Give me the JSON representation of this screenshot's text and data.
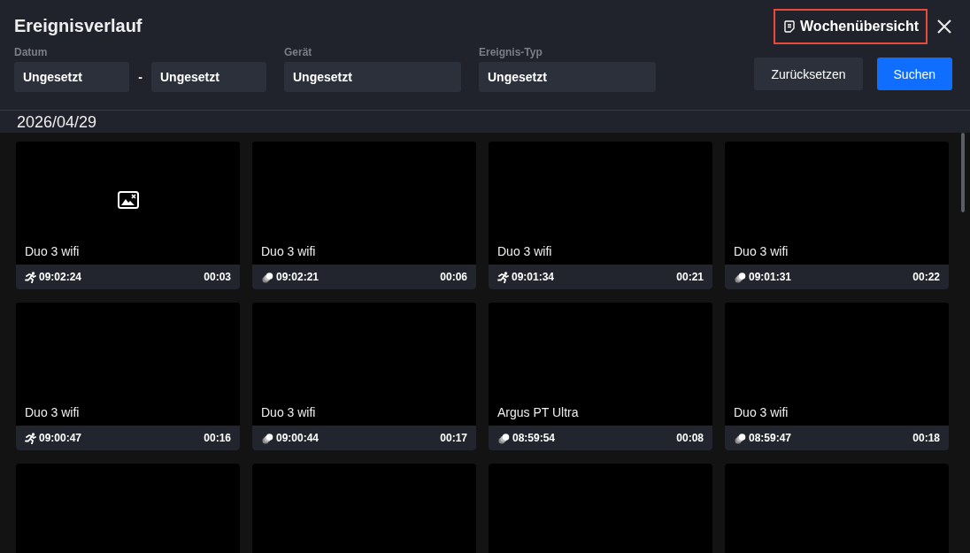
{
  "window": {
    "title": "Ereignisverlauf"
  },
  "week_overview": {
    "label": "Wochenübersicht",
    "highlighted": true
  },
  "filters": {
    "date": {
      "label": "Datum",
      "from": "Ungesetzt",
      "separator": "-",
      "to": "Ungesetzt"
    },
    "device": {
      "label": "Gerät",
      "value": "Ungesetzt"
    },
    "event_type": {
      "label": "Ereignis-Typ",
      "value": "Ungesetzt"
    }
  },
  "buttons": {
    "reset": "Zurücksetzen",
    "search": "Suchen"
  },
  "date_heading": "2026/04/29",
  "cards": [
    {
      "kind": "person",
      "device": "Duo 3 wifi",
      "time": "09:02:24",
      "duration": "00:03",
      "image_missing": true
    },
    {
      "kind": "motion",
      "device": "Duo 3 wifi",
      "time": "09:02:21",
      "duration": "00:06",
      "image_missing": false
    },
    {
      "kind": "person",
      "device": "Duo 3 wifi",
      "time": "09:01:34",
      "duration": "00:21",
      "image_missing": false
    },
    {
      "kind": "motion",
      "device": "Duo 3 wifi",
      "time": "09:01:31",
      "duration": "00:22",
      "image_missing": false
    },
    {
      "kind": "person",
      "device": "Duo 3 wifi",
      "time": "09:00:47",
      "duration": "00:16",
      "image_missing": false
    },
    {
      "kind": "motion",
      "device": "Duo 3 wifi",
      "time": "09:00:44",
      "duration": "00:17",
      "image_missing": false
    },
    {
      "kind": "motion",
      "device": "Argus PT Ultra",
      "time": "08:59:54",
      "duration": "00:08",
      "image_missing": false
    },
    {
      "kind": "motion",
      "device": "Duo 3 wifi",
      "time": "08:59:47",
      "duration": "00:18",
      "image_missing": false
    },
    {
      "kind": "cut"
    },
    {
      "kind": "cut"
    },
    {
      "kind": "cut"
    },
    {
      "kind": "cut"
    }
  ]
}
